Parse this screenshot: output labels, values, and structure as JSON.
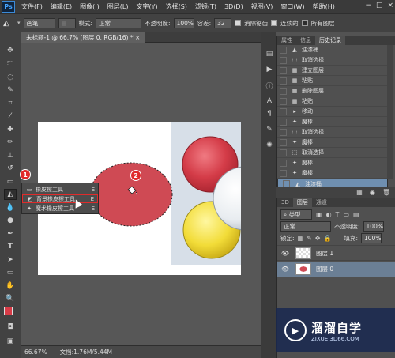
{
  "app": {
    "logo": "Ps"
  },
  "menubar": {
    "items": [
      "文件(F)",
      "编辑(E)",
      "图像(I)",
      "图层(L)",
      "文字(Y)",
      "选择(S)",
      "滤镜(T)",
      "3D(D)",
      "视图(V)",
      "窗口(W)",
      "帮助(H)"
    ],
    "window_controls": [
      "−",
      "□",
      "×"
    ]
  },
  "options_bar": {
    "source_select": "画笔",
    "mode_label": "模式:",
    "mode_value": "正常",
    "opacity_label": "不透明度:",
    "opacity_value": "100%",
    "tolerance_label": "容差:",
    "tolerance_value": "32",
    "antialias_label": "消除锯齿",
    "contiguous_label": "连续的",
    "all_layers_label": "所有图层"
  },
  "document": {
    "tab_title": "未标题-1 @ 66.7% (图层 0, RGB/16) * ×",
    "zoom": "66.67%",
    "doc_info": "文档:1.76M/5.44M"
  },
  "flyout": {
    "items": [
      {
        "label": "橡皮擦工具",
        "key": "E",
        "icon": "eraser-icon"
      },
      {
        "label": "背景橡皮擦工具",
        "key": "E",
        "icon": "background-eraser-icon"
      },
      {
        "label": "魔术橡皮擦工具",
        "key": "E",
        "icon": "magic-eraser-icon"
      }
    ]
  },
  "markers": {
    "one": "1",
    "two": "2"
  },
  "history_panel": {
    "tabs": [
      "属性",
      "信息",
      "历史记录"
    ],
    "active_tab": "历史记录",
    "items": [
      {
        "label": "油漆桶",
        "icon": "paint-bucket-icon"
      },
      {
        "label": "取消选择",
        "icon": "deselect-icon"
      },
      {
        "label": "建立图层",
        "icon": "new-layer-icon"
      },
      {
        "label": "粘贴",
        "icon": "paste-icon"
      },
      {
        "label": "删除图层",
        "icon": "delete-layer-icon"
      },
      {
        "label": "粘贴",
        "icon": "paste-icon"
      },
      {
        "label": "移动",
        "icon": "move-icon"
      },
      {
        "label": "魔棒",
        "icon": "magic-wand-icon"
      },
      {
        "label": "取消选择",
        "icon": "deselect-icon"
      },
      {
        "label": "魔棒",
        "icon": "magic-wand-icon"
      },
      {
        "label": "取消选择",
        "icon": "deselect-icon"
      },
      {
        "label": "魔棒",
        "icon": "magic-wand-icon"
      },
      {
        "label": "魔棒",
        "icon": "magic-wand-icon"
      },
      {
        "label": "油漆桶",
        "icon": "paint-bucket-icon"
      }
    ],
    "selected_index": 13
  },
  "layers_panel": {
    "tabs": [
      "3D",
      "图层",
      "通道"
    ],
    "active_tab": "图层",
    "filter_label": "类型",
    "blend_mode": "正常",
    "opacity_label": "不透明度:",
    "opacity_value": "100%",
    "lock_label": "锁定:",
    "fill_label": "填充:",
    "fill_value": "100%",
    "layers": [
      {
        "name": "图层 1",
        "visible": true,
        "active": false
      },
      {
        "name": "图层 0",
        "visible": true,
        "active": true
      }
    ]
  },
  "watermark": {
    "title": "溜溜自学",
    "subtitle": "ZIXUE.3D66.COM"
  },
  "colors": {
    "foreground": "#d83b47",
    "background": "#ffffff",
    "accent": "#e02b2b"
  }
}
